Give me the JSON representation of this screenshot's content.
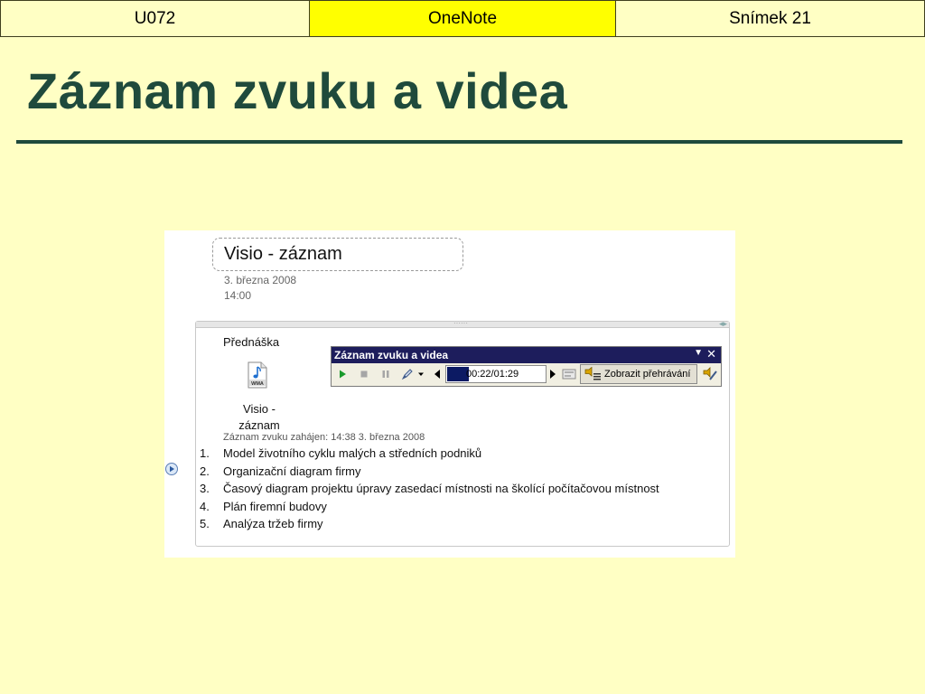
{
  "header": {
    "cells": [
      "U072",
      "OneNote",
      "Snímek 21"
    ],
    "highlight_color": "#ffff00"
  },
  "slide": {
    "title": "Záznam zvuku a videa",
    "background": "#ffffc4",
    "title_color": "#1f4a3c"
  },
  "onenote": {
    "page_title": "Visio - záznam",
    "date": "3. března 2008",
    "time": "14:00",
    "section_heading": "Přednáška",
    "attachment_label": "Visio - záznam",
    "attachment_icon": "wma-audio-file-icon",
    "recording_started": "Záznam zvuku zahájen: 14:38 3. března 2008",
    "list": [
      {
        "num": "1.",
        "text": "Model životního cyklu malých a středních podniků"
      },
      {
        "num": "2.",
        "text": "Organizační diagram firmy"
      },
      {
        "num": "3.",
        "text": "Časový diagram projektu úpravy zasedací místnosti na školící počítačovou místnost"
      },
      {
        "num": "4.",
        "text": "Plán firemní budovy"
      },
      {
        "num": "5.",
        "text": "Analýza tržeb firmy"
      }
    ]
  },
  "toolbar": {
    "title": "Záznam zvuku a videa",
    "time": "00:22/01:29",
    "show_playback_label": "Zobrazit přehrávání",
    "icons": [
      "play-icon",
      "stop-icon",
      "pause-icon",
      "pen-icon",
      "dropdown-icon",
      "rewind-icon",
      "forward-icon",
      "note-link-icon",
      "audio-options-icon"
    ]
  }
}
